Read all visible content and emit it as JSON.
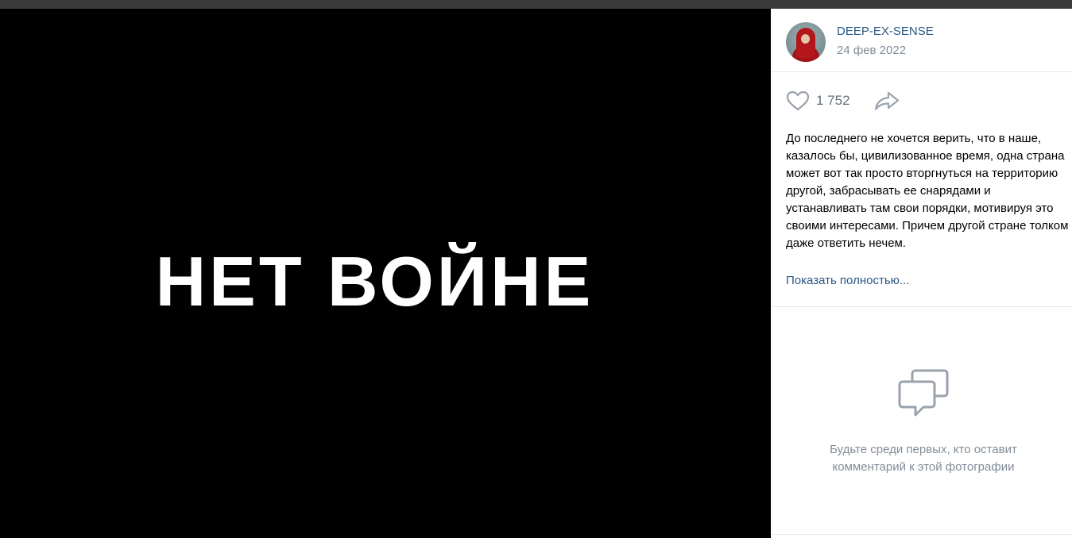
{
  "photo": {
    "text": "НЕТ ВОЙНЕ"
  },
  "post": {
    "author": "DEEP-EX-SENSE",
    "date": "24 фев 2022",
    "likes": "1 752",
    "text": "До последнего не хочется верить, что в наше, казалось бы, цивилизованное время, одна страна может вот так просто вторгнуться на территорию другой, забрасывать ее снарядами и устанавливать там свои порядки, мотивируя это своими интересами. Причем другой стране толком даже ответить нечем.",
    "show_more": "Показать полностью..."
  },
  "comments": {
    "empty_line1": "Будьте среди первых, кто оставит",
    "empty_line2": "комментарий к этой фотографии"
  },
  "icons": {
    "like": "heart-icon",
    "share": "share-icon",
    "comments": "comment-bubbles-icon"
  },
  "colors": {
    "link": "#2a5885",
    "secondary": "#818c99",
    "icon": "#99a2ad"
  }
}
